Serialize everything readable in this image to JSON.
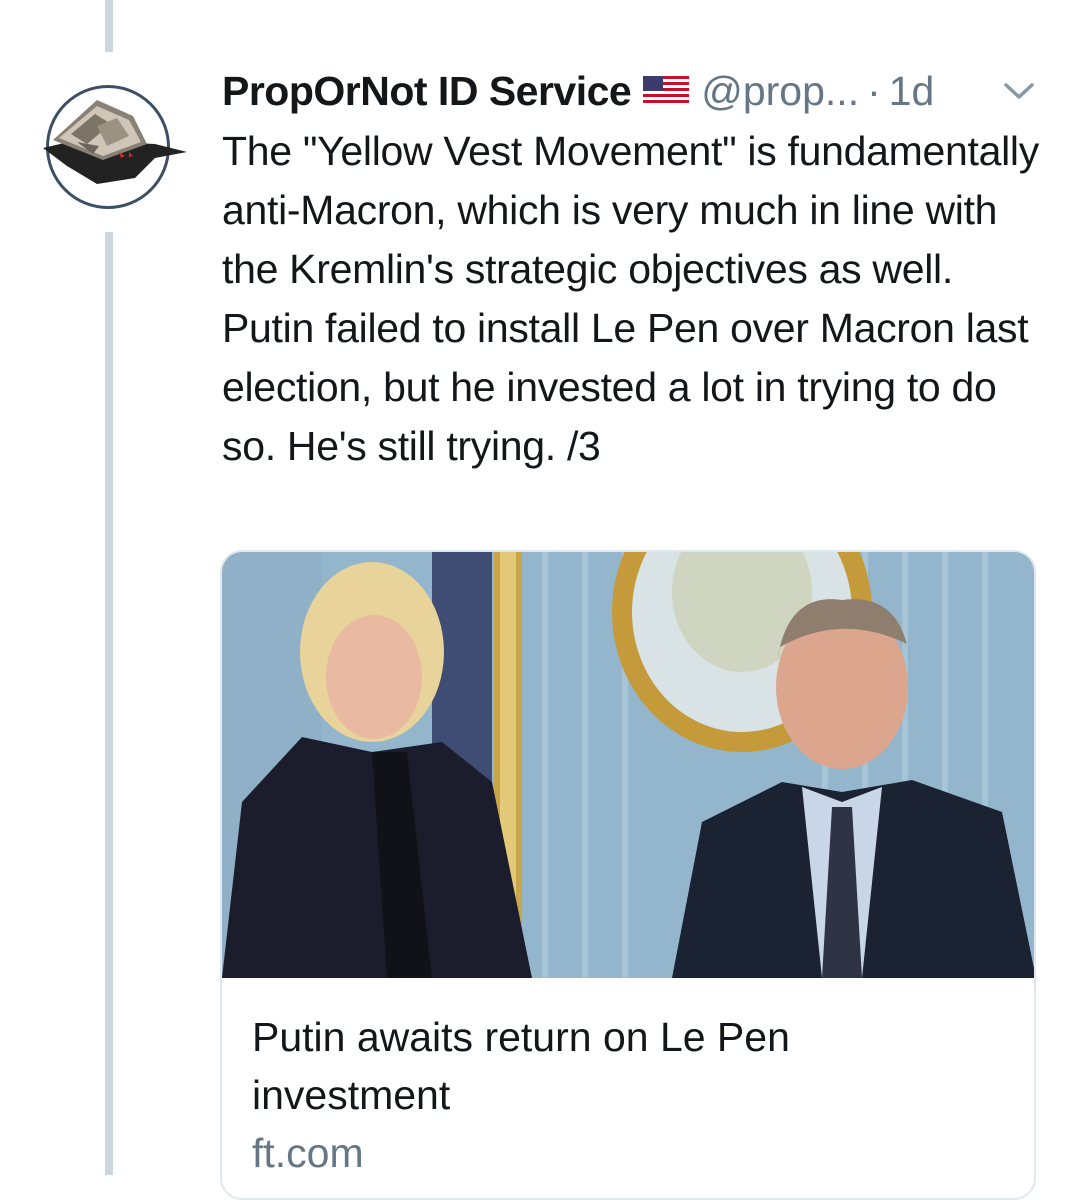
{
  "tweet": {
    "author": {
      "display_name": "PropOrNot ID Service",
      "handle": "@prop...",
      "flag_icon": "us-flag-icon",
      "avatar_icon": "proporNot-logo-icon"
    },
    "separator": "·",
    "time": "1d",
    "menu_icon": "chevron-down-icon",
    "text": "The \"Yellow Vest Movement\" is fundamentally anti-Macron, which is very much in line with the Kremlin's strategic objectives as well. Putin failed to install Le Pen over Macron last election, but he invested a lot in trying to do so. He's still trying. /3",
    "card": {
      "title": "Putin awaits return on Le Pen investment",
      "domain": "ft.com",
      "image_icon": "article-photo"
    }
  },
  "colors": {
    "primary_text": "#14171a",
    "secondary_text": "#657786",
    "border": "#e1e8ed",
    "thread_line": "#ccd6dd"
  }
}
